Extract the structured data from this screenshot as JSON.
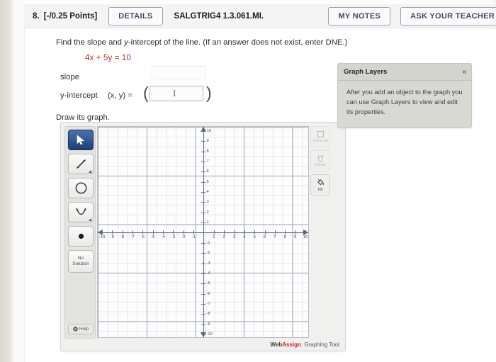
{
  "header": {
    "question_number": "8.",
    "points": "[-/0.25 Points]",
    "details_label": "DETAILS",
    "question_code": "SALGTRIG4 1.3.061.MI.",
    "my_notes_label": "MY NOTES",
    "ask_teacher_label": "ASK YOUR TEACHER"
  },
  "question": {
    "prompt_part1": "Find the slope and ",
    "prompt_italic": "y",
    "prompt_part2": "-intercept of the line. (If an answer does not exist, enter DNE.)",
    "equation": "4x + 5y = 10",
    "slope_label": "slope",
    "slope_value": "",
    "slope_placeholder": "",
    "yintercept_label": "y-intercept",
    "xy_label": "(x, y) =",
    "paren_open": "(",
    "paren_close": ")",
    "yintercept_value": "",
    "yintercept_placeholder": "",
    "caret_glyph": "I",
    "draw_label": "Draw its graph."
  },
  "graph_tool": {
    "tools": [
      {
        "name": "pointer-tool",
        "label": "Pointer",
        "selected": true
      },
      {
        "name": "line-tool",
        "label": "Line",
        "selected": false
      },
      {
        "name": "circle-tool",
        "label": "Circle",
        "selected": false
      },
      {
        "name": "parabola-tool",
        "label": "Parabola",
        "selected": false
      },
      {
        "name": "point-tool",
        "label": "Point",
        "selected": false
      },
      {
        "name": "no-solution-tool",
        "label_line1": "No",
        "label_line2": "Solution",
        "selected": false
      }
    ],
    "help_label": "Help",
    "right_tools": [
      {
        "name": "undo-tool",
        "label": "Clear All",
        "disabled": true
      },
      {
        "name": "delete-tool",
        "label": "Delete",
        "disabled": true
      },
      {
        "name": "fill-tool",
        "label": "Fill",
        "disabled": false
      }
    ],
    "branding_prefix": "Web",
    "branding_accent": "Assign",
    "branding_suffix": ". Graphing Tool"
  },
  "layers_panel": {
    "title": "Graph Layers",
    "collapse_glyph": "«",
    "body_text": "After you add an object to the graph you can use Graph Layers to view and edit its properties."
  },
  "chart_data": {
    "type": "scatter",
    "title": "",
    "xlabel": "",
    "ylabel": "",
    "xlim": [
      -10,
      10
    ],
    "ylim": [
      -10,
      10
    ],
    "grid": true,
    "legend": "none",
    "x_ticks": [
      -10,
      -9,
      -8,
      -7,
      -6,
      -5,
      -4,
      -3,
      -2,
      -1,
      1,
      2,
      3,
      4,
      5,
      6,
      7,
      8,
      9,
      10
    ],
    "y_ticks": [
      10,
      9,
      8,
      7,
      6,
      5,
      4,
      3,
      2,
      1,
      -1,
      -2,
      -3,
      -4,
      -5,
      -6,
      -7,
      -8,
      -9,
      -10
    ],
    "series": [],
    "note": "Empty coordinate grid; no objects plotted yet."
  },
  "colors": {
    "equation_red": "#b03a3a",
    "accent_blue": "#3f4a66",
    "brand_red": "#cf2027",
    "selected_tool": "#1d3f72"
  }
}
